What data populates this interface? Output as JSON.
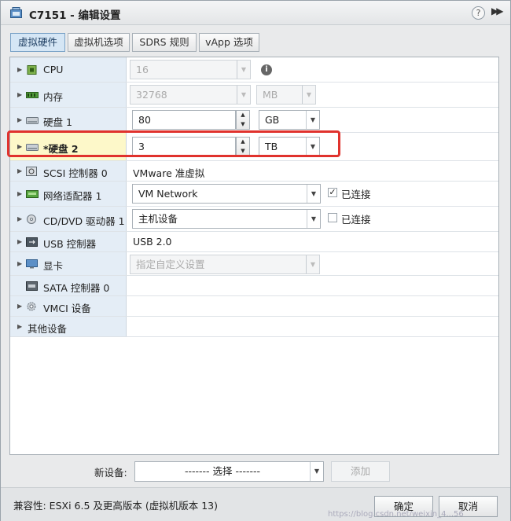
{
  "window": {
    "title": "C7151 - 编辑设置",
    "help_label": "?",
    "more_label": "▶▶"
  },
  "tabs": [
    {
      "label": "虚拟硬件",
      "active": true
    },
    {
      "label": "虚拟机选项",
      "active": false
    },
    {
      "label": "SDRS 规则",
      "active": false
    },
    {
      "label": "vApp 选项",
      "active": false
    }
  ],
  "rows": {
    "cpu": {
      "label": "CPU",
      "value": "16"
    },
    "memory": {
      "label": "内存",
      "value": "32768",
      "unit": "MB"
    },
    "disk1": {
      "label": "硬盘 1",
      "value": "80",
      "unit": "GB"
    },
    "disk2": {
      "label": "*硬盘 2",
      "value": "3",
      "unit": "TB"
    },
    "scsi": {
      "label": "SCSI 控制器 0",
      "value": "VMware 准虚拟"
    },
    "network": {
      "label": "网络适配器 1",
      "value": "VM Network",
      "connected_label": "已连接",
      "connected": true
    },
    "cdrom": {
      "label": "CD/DVD 驱动器 1",
      "value": "主机设备",
      "connected_label": "已连接",
      "connected": false
    },
    "usb": {
      "label": "USB 控制器",
      "value": "USB 2.0"
    },
    "video": {
      "label": "显卡",
      "value": "指定自定义设置"
    },
    "sata": {
      "label": "SATA 控制器 0"
    },
    "vmci": {
      "label": "VMCI 设备"
    },
    "other": {
      "label": "其他设备"
    }
  },
  "new_device": {
    "label": "新设备:",
    "select_value": "------- 选择 -------",
    "add_label": "添加"
  },
  "footer": {
    "compat": "兼容性: ESXi 6.5 及更高版本 (虚拟机版本 13)",
    "ok_label": "确定",
    "cancel_label": "取消",
    "watermark": "https://blog.csdn.net/weixin_4...56"
  },
  "colors": {
    "highlight_border": "#e0322d",
    "label_bg": "#e4edf6",
    "active_tab": "#d5e6f5"
  }
}
